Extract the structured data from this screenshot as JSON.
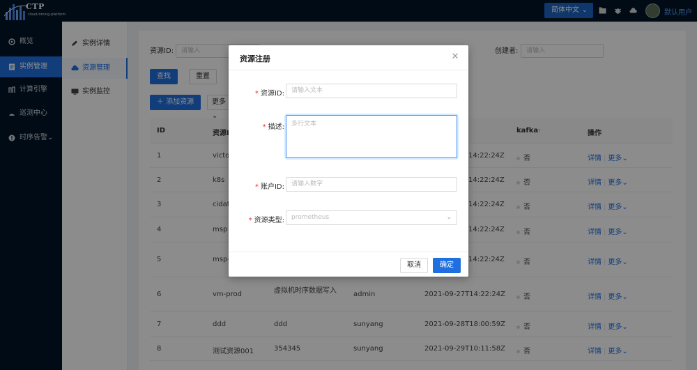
{
  "app": {
    "logo_title": "CTP",
    "logo_subtitle": "cloud-timing-platform"
  },
  "header": {
    "lang_label": "简体中文",
    "user_name": "默认用户"
  },
  "sidebar": {
    "items": [
      {
        "label": "概览"
      },
      {
        "label": "实例管理"
      },
      {
        "label": "计算引擎"
      },
      {
        "label": "巡测中心"
      },
      {
        "label": "时序告警"
      }
    ]
  },
  "subnav": {
    "items": [
      {
        "label": "实例详情"
      },
      {
        "label": "资源管理"
      },
      {
        "label": "实例监控"
      }
    ]
  },
  "filter": {
    "resource_id_label": "资源ID:",
    "resource_id_placeholder": "请输入",
    "creator_label": "创建者:",
    "creator_placeholder": "请输入",
    "search_label": "查找",
    "reset_label": "重置",
    "add_label": "添加资源",
    "more_label": "更多"
  },
  "table": {
    "headers": {
      "id": "ID",
      "resource": "资源I",
      "kafka": "kafka",
      "ops": "操作"
    },
    "rows": [
      {
        "id": "1",
        "name": "victo",
        "desc": "",
        "creator": "",
        "time": "14:22:24Z",
        "kafka": "否"
      },
      {
        "id": "2",
        "name": "k8s",
        "desc": "",
        "creator": "",
        "time": "14:22:24Z",
        "kafka": "否"
      },
      {
        "id": "3",
        "name": "cidata",
        "desc": "",
        "creator": "",
        "time": "14:22:24Z",
        "kafka": "否"
      },
      {
        "id": "4",
        "name": "msp",
        "desc": "",
        "creator": "",
        "time": "14:22:24Z",
        "kafka": "否"
      },
      {
        "id": "5",
        "name": "msp-",
        "desc": "",
        "creator": "",
        "time": "14:22:24Z",
        "kafka": "否"
      },
      {
        "id": "6",
        "name": "vm-prod",
        "desc": "虚拟机时序数据写入",
        "creator": "admin",
        "time": "2021-09-27T14:22:24Z",
        "kafka": "否"
      },
      {
        "id": "7",
        "name": "ddd",
        "desc": "ddd",
        "creator": "sunyang",
        "time": "2021-09-28T18:00:59Z",
        "kafka": "否"
      },
      {
        "id": "8",
        "name": "测试资源001",
        "desc": "354345",
        "creator": "sunyang",
        "time": "2021-09-29T10:11:58Z",
        "kafka": "否"
      }
    ],
    "op_detail": "详情",
    "op_more": "更多"
  },
  "modal": {
    "title": "资源注册",
    "fields": {
      "resource_id": {
        "label": "资源ID:",
        "placeholder": "请输入文本"
      },
      "desc": {
        "label": "描述:",
        "placeholder": "多行文本"
      },
      "account_id": {
        "label": "账户ID:",
        "placeholder": "请输入数字"
      },
      "resource_type": {
        "label": "资源类型:",
        "value": "prometheus"
      }
    },
    "cancel_label": "取消",
    "ok_label": "确定"
  },
  "colors": {
    "primary": "#1f6fe0",
    "sidebar_bg": "#001529",
    "required": "#f5222d"
  }
}
